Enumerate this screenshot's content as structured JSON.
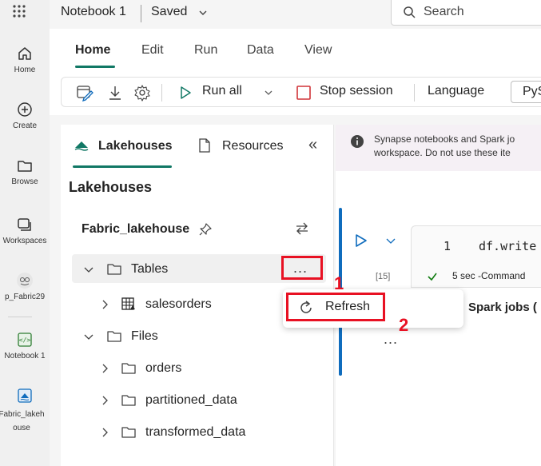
{
  "rail": {
    "items": [
      {
        "label": "Home",
        "icon": "home-icon"
      },
      {
        "label": "Create",
        "icon": "create-icon"
      },
      {
        "label": "Browse",
        "icon": "browse-icon"
      },
      {
        "label": "Workspaces",
        "icon": "workspaces-icon"
      },
      {
        "label": "p_Fabric29",
        "icon": "workspace-avatar-icon"
      },
      {
        "label": "Notebook 1",
        "icon": "notebook-icon"
      },
      {
        "label": "Fabric_lakeh ouse",
        "icon": "lakehouse-icon"
      }
    ]
  },
  "topbar": {
    "title": "Notebook 1",
    "saved": "Saved",
    "search_placeholder": "Search"
  },
  "ribbon": {
    "tabs": [
      "Home",
      "Edit",
      "Run",
      "Data",
      "View"
    ],
    "active_tab": "Home",
    "run_all": "Run all",
    "stop_session": "Stop session",
    "language_label": "Language",
    "language_value": "PyS"
  },
  "panel": {
    "tab_lakehouses": "Lakehouses",
    "tab_resources": "Resources",
    "heading": "Lakehouses",
    "lakehouse_name": "Fabric_lakehouse",
    "tree": [
      {
        "label": "Tables",
        "expanded": true,
        "level": 0,
        "icon": "folder-icon"
      },
      {
        "label": "salesorders",
        "expanded": false,
        "level": 1,
        "icon": "table-icon"
      },
      {
        "label": "Files",
        "expanded": true,
        "level": 0,
        "icon": "folder-icon"
      },
      {
        "label": "orders",
        "expanded": false,
        "level": 1,
        "icon": "folder-icon"
      },
      {
        "label": "partitioned_data",
        "expanded": false,
        "level": 1,
        "icon": "folder-icon"
      },
      {
        "label": "transformed_data",
        "expanded": false,
        "level": 1,
        "icon": "folder-icon"
      }
    ],
    "more_label": "..."
  },
  "context_menu": {
    "refresh": "Refresh"
  },
  "annotations": {
    "step1": "1",
    "step2": "2",
    "color": "#e81123"
  },
  "content": {
    "banner_line1": "Synapse notebooks and Spark jo",
    "banner_line2": "workspace. Do not use these ite",
    "line_number": "1",
    "code": "df.write",
    "exec_count": "[15]",
    "exec_status": "5 sec -Command",
    "spark_jobs": "Spark jobs (",
    "ellipsis": "..."
  },
  "colors": {
    "accent": "#117865",
    "run_blue": "#0f6cbd",
    "stop_red": "#d13438",
    "highlight_red": "#e81123"
  }
}
